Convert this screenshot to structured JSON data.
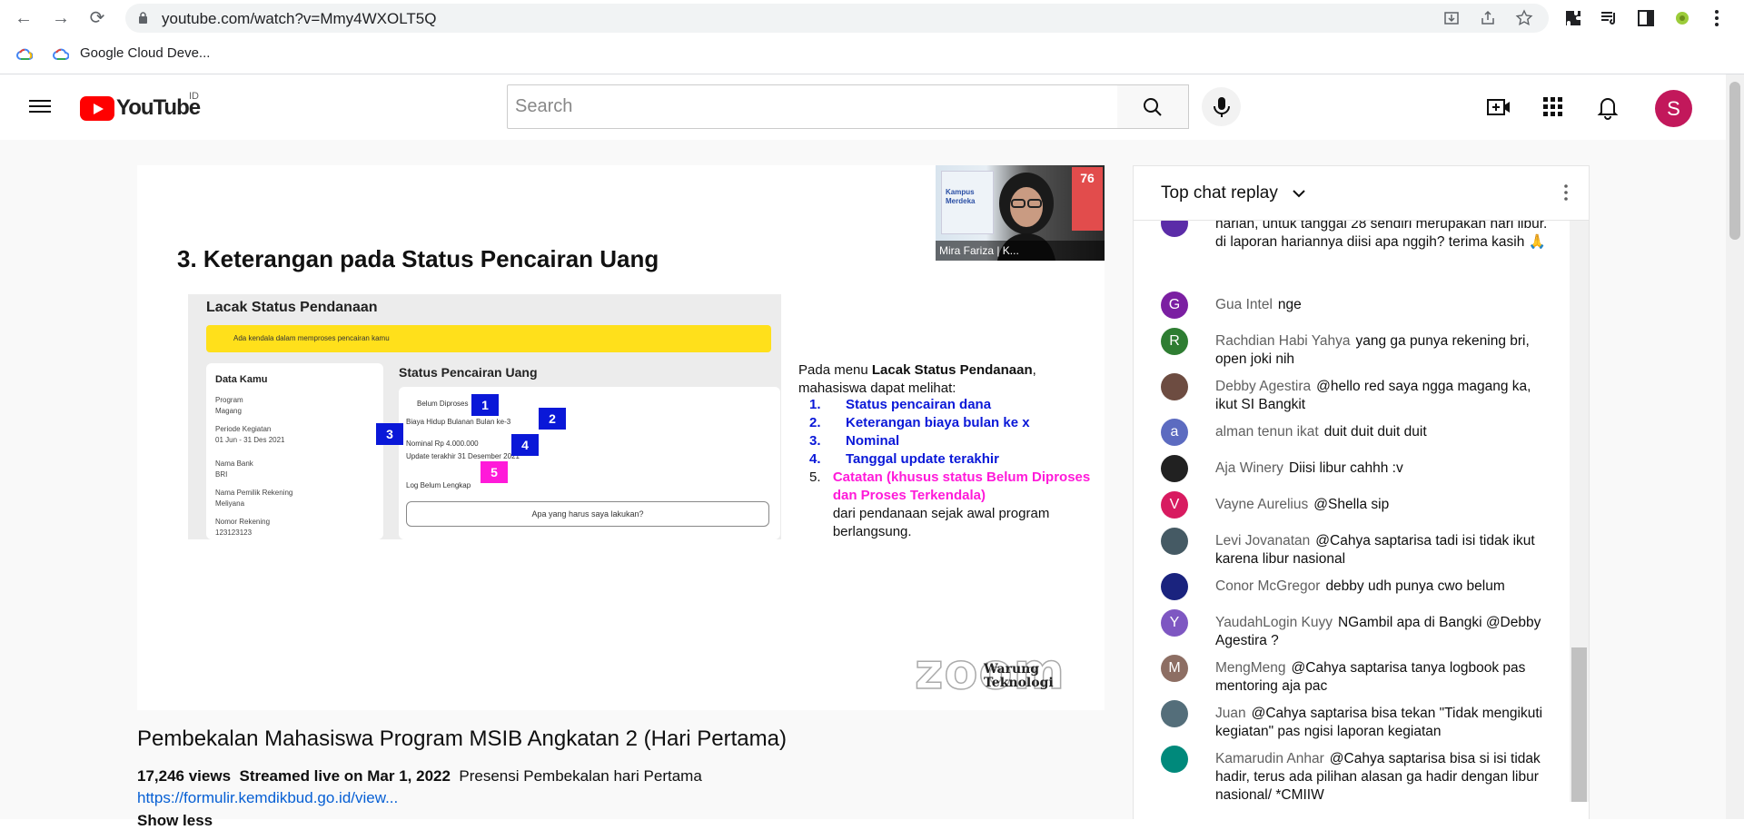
{
  "browser": {
    "back": "←",
    "forward": "→",
    "reload": "⟳",
    "url": "youtube.com/watch?v=Mmy4WXOLT5Q",
    "bookmarks": [
      {
        "label": "Google Cloud Deve..."
      }
    ]
  },
  "header": {
    "logo_text": "YouTube",
    "region": "ID",
    "search_placeholder": "Search",
    "avatar_letter": "S"
  },
  "slide": {
    "title": "3.  Keterangan pada Status Pencairan Uang",
    "screenshot": {
      "left_heading": "Lacak Status Pendanaan",
      "banner": "Ada kendala dalam memproses pencairan kamu",
      "card_heading": "Data Kamu",
      "card_lines": [
        "Program",
        "Magang",
        "Periode Kegiatan",
        "01 Jun - 31 Des 2021",
        "Nama Bank",
        "BRI",
        "Nama Pemilik Rekening",
        "Meliyana",
        "Nomor Rekening",
        "123123123"
      ],
      "right_heading": "Status Pencairan Uang",
      "right_lines": [
        "Belum Diproses",
        "Biaya Hidup Bulanan Bulan ke-3",
        "Nominal Rp 4.000.000",
        "Update terakhir 31 Desember 2021",
        "Log Belum Lengkap"
      ],
      "help": "Apa yang harus saya lakukan?",
      "badges": [
        "1",
        "2",
        "3",
        "4",
        "5"
      ]
    },
    "intro": "Pada menu Lacak Status Pendanaan, mahasiswa dapat melihat:",
    "intro_bold": "Lacak Status Pendanaan",
    "items": [
      {
        "n": "1.",
        "text": "Status pencairan dana"
      },
      {
        "n": "2.",
        "text": "Keterangan biaya bulan ke x"
      },
      {
        "n": "3.",
        "text": "Nominal"
      },
      {
        "n": "4.",
        "text": "Tanggal update terakhir"
      },
      {
        "n": "5.",
        "text": "Catatan (khusus status Belum Diproses dan Proses Terkendala)"
      }
    ],
    "item5_tail": "dari pendanaan sejak awal program berlangsung.",
    "webcam_name": "Mira Fariza | K...",
    "webcam_poster": "Kampus Merdeka",
    "webcam_badge": "76",
    "watermark": "zoom",
    "watermark2": "Warung Teknologi"
  },
  "video": {
    "title": "Pembekalan Mahasiswa Program MSIB Angkatan 2 (Hari Pertama)",
    "views": "17,246 views",
    "streamed": "Streamed live on Mar 1, 2022",
    "desc": "Presensi Pembekalan hari Pertama",
    "link": "https://formulir.kemdikbud.go.id/view...",
    "show_less": "Show less"
  },
  "chat": {
    "header": "Top chat replay",
    "messages": [
      {
        "author": "",
        "text": "harian, untuk tanggal 28 sendiri merupakan hari libur. di laporan hariannya diisi apa nggih? terima kasih 🙏",
        "avatar": "",
        "color": "#5b2ca8"
      },
      {
        "author": "Gua Intel",
        "text": "nge",
        "avatar": "G",
        "color": "#7b1fa2"
      },
      {
        "author": "Rachdian Habi Yahya",
        "text": "yang ga punya rekening bri, open joki nih",
        "avatar": "R",
        "color": "#2e7d32"
      },
      {
        "author": "Debby Agestira",
        "text": "@hello red saya ngga magang ka, ikut SI Bangkit",
        "avatar": "",
        "color": "#6d4c41"
      },
      {
        "author": "alman tenun ikat",
        "text": "duit duit duit duit",
        "avatar": "a",
        "color": "#5c6bc0"
      },
      {
        "author": "Aja Winery",
        "text": "Diisi libur cahhh :v",
        "avatar": "",
        "color": "#212121"
      },
      {
        "author": "Vayne Aurelius",
        "text": "@Shella sip",
        "avatar": "V",
        "color": "#d81b60"
      },
      {
        "author": "Levi Jovanatan",
        "text": "@Cahya saptarisa tadi isi tidak ikut karena libur nasional",
        "avatar": "",
        "color": "#455a64"
      },
      {
        "author": "Conor McGregor",
        "text": "debby udh punya cwo belum",
        "avatar": "",
        "color": "#1a237e"
      },
      {
        "author": "YaudahLogin Kuyy",
        "text": "NGambil apa di Bangki @Debby Agestira ?",
        "avatar": "Y",
        "color": "#7e57c2"
      },
      {
        "author": "MengMeng",
        "text": "@Cahya saptarisa tanya logbook pas mentoring aja pac",
        "avatar": "M",
        "color": "#8d6e63"
      },
      {
        "author": "Juan",
        "text": "@Cahya saptarisa bisa tekan \"Tidak mengikuti kegiatan\" pas ngisi laporan kegiatan",
        "avatar": "",
        "color": "#546e7a"
      },
      {
        "author": "Kamarudin Anhar",
        "text": "@Cahya saptarisa bisa si isi tidak hadir, terus ada pilihan alasan ga hadir dengan libur nasional/ *CMIIW",
        "avatar": "",
        "color": "#00897b"
      }
    ]
  }
}
